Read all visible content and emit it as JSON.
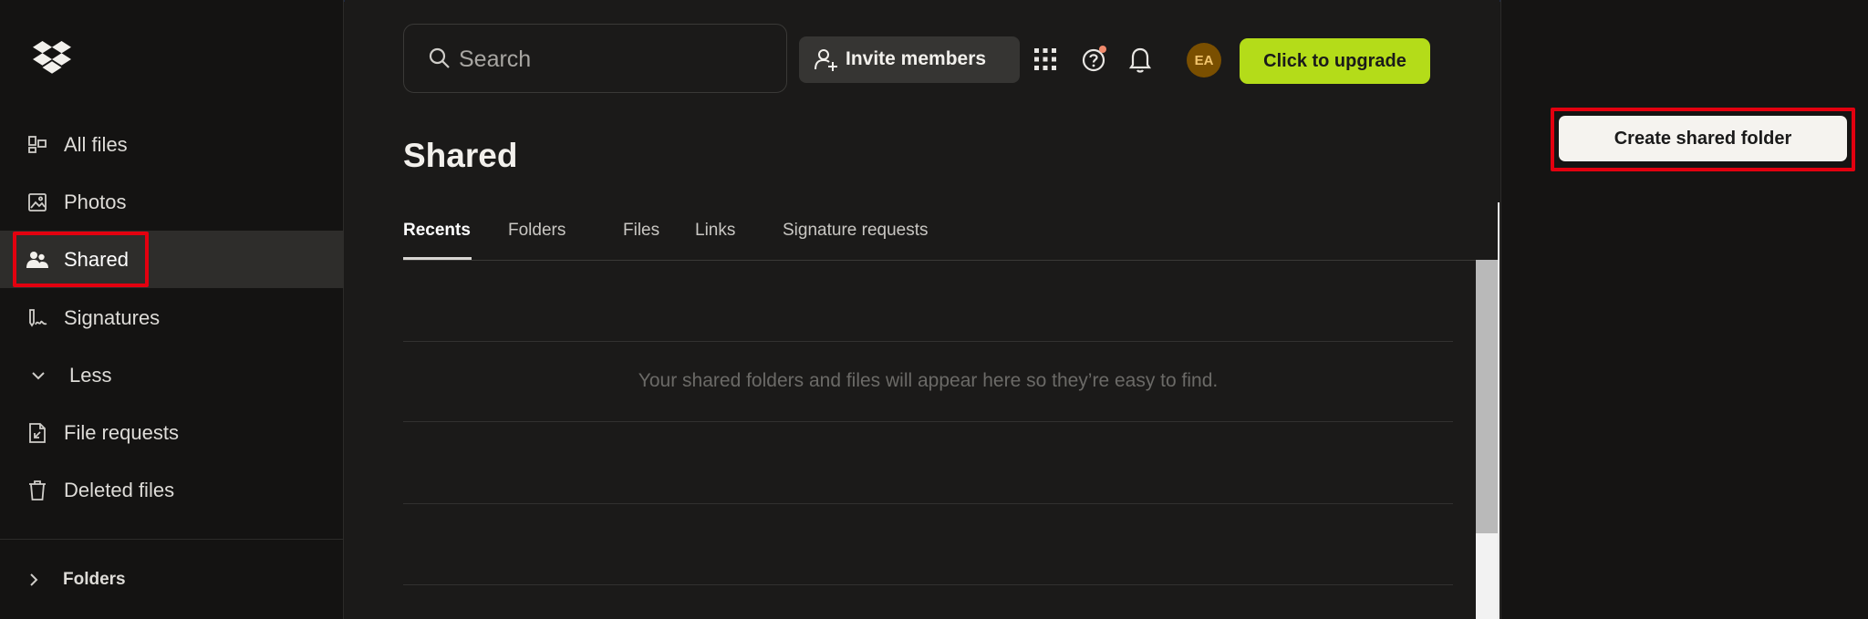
{
  "sidebar": {
    "items": [
      {
        "label": "All files",
        "icon": "all-files-icon"
      },
      {
        "label": "Photos",
        "icon": "photo-icon"
      },
      {
        "label": "Shared",
        "icon": "people-icon",
        "active": true
      },
      {
        "label": "Signatures",
        "icon": "signature-icon"
      },
      {
        "label": "Less",
        "icon": "chevron-down-icon"
      },
      {
        "label": "File requests",
        "icon": "file-request-icon"
      },
      {
        "label": "Deleted files",
        "icon": "trash-icon"
      }
    ],
    "folders_label": "Folders"
  },
  "header": {
    "search_placeholder": "Search",
    "invite_label": "Invite members",
    "avatar_initials": "EA",
    "upgrade_label": "Click to upgrade"
  },
  "main": {
    "title": "Shared",
    "tabs": [
      {
        "label": "Recents",
        "active": true
      },
      {
        "label": "Folders"
      },
      {
        "label": "Files"
      },
      {
        "label": "Links"
      },
      {
        "label": "Signature requests"
      }
    ],
    "empty_message": "Your shared folders and files will appear here so they’re easy to find."
  },
  "right_panel": {
    "create_label": "Create shared folder"
  },
  "colors": {
    "background": "#1b1a19",
    "sidebar": "#141312",
    "upgrade_accent": "#b4dc19",
    "highlight_box": "#e3000f",
    "avatar_bg": "#7a4f00"
  }
}
